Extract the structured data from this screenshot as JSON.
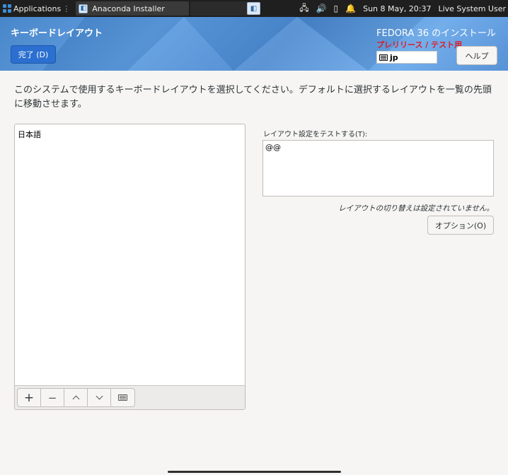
{
  "system_panel": {
    "applications_label": "Applications",
    "applications_dots": "⋮",
    "task_label": "Anaconda Installer",
    "datetime": "Sun 8 May, 20:37",
    "user": "Live System User"
  },
  "header": {
    "spoke_title": "キーボードレイアウト",
    "done_button": "完了 (D)",
    "product_title": "FEDORA 36 のインストール",
    "prerelease_label": "プレリリース / テスト用",
    "keyboard_indicator": "jp",
    "help_button": "ヘルプ"
  },
  "main": {
    "instructions": "このシステムで使用するキーボードレイアウトを選択してください。デフォルトに選択するレイアウトを一覧の先頭に移動させます。",
    "layouts": [
      {
        "label": "日本語"
      }
    ],
    "test_label": "レイアウト設定をテストする(T):",
    "test_value": "@@",
    "switch_note": "レイアウトの切り替えは設定されていません。",
    "options_button": "オプション(O)"
  },
  "colors": {
    "accent": "#2b6fd0",
    "prerelease": "#e01b24",
    "header_blue": "#4a88d0"
  },
  "icons": {
    "add": "+",
    "remove": "−",
    "move_up": "chevron-up-icon",
    "move_down": "chevron-down-icon",
    "preview": "keyboard-icon"
  }
}
